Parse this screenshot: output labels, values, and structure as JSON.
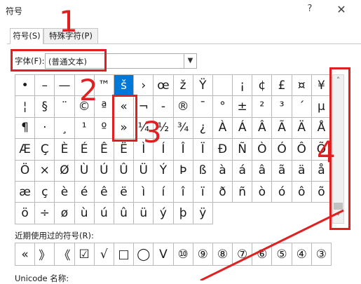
{
  "window": {
    "title": "符号",
    "help_label": "?",
    "close_label": "✕"
  },
  "tabs": [
    {
      "label": "符号(S)",
      "active": true
    },
    {
      "label": "特殊字符(P)",
      "active": false
    }
  ],
  "font": {
    "label": "字体(F):",
    "value": "(普通文本)",
    "dropdown_icon": "chevron-down-icon"
  },
  "symbols": [
    [
      "•",
      "–",
      "—",
      "˜",
      "™",
      "š",
      "›",
      "œ",
      "ž",
      "Ÿ",
      "",
      "¡",
      "¢",
      "£",
      "¤",
      "¥"
    ],
    [
      "¦",
      "§",
      "¨",
      "©",
      "ª",
      "«",
      "¬",
      "-",
      "®",
      "¯",
      "°",
      "±",
      "²",
      "³",
      "´",
      "µ"
    ],
    [
      "¶",
      "·",
      "¸",
      "¹",
      "º",
      "»",
      "¼",
      "½",
      "¾",
      "¿",
      "À",
      "Á",
      "Â",
      "Ã",
      "Ä",
      "Å"
    ],
    [
      "Æ",
      "Ç",
      "È",
      "É",
      "Ê",
      "Ë",
      "Ì",
      "Í",
      "Î",
      "Ï",
      "Ð",
      "Ñ",
      "Ò",
      "Ó",
      "Ô",
      "Õ"
    ],
    [
      "Ö",
      "×",
      "Ø",
      "Ù",
      "Ú",
      "Û",
      "Ü",
      "Ý",
      "Þ",
      "ß",
      "à",
      "á",
      "â",
      "ã",
      "ä",
      "å"
    ],
    [
      "æ",
      "ç",
      "è",
      "é",
      "ê",
      "ë",
      "ì",
      "í",
      "î",
      "ï",
      "ð",
      "ñ",
      "ò",
      "ó",
      "ô",
      "õ"
    ],
    [
      "ö",
      "÷",
      "ø",
      "ù",
      "ú",
      "û",
      "ü",
      "ý",
      "þ",
      "ÿ",
      "",
      "",
      "",
      "",
      "",
      ""
    ]
  ],
  "selected_symbol": "š",
  "recent": {
    "label": "近期使用过的符号(R):",
    "symbols": [
      "«",
      "》",
      "《",
      "☑",
      "√",
      "□",
      "◯",
      "V",
      "⑩",
      "⑨",
      "⑧",
      "⑦",
      "⑥",
      "⑤",
      "④",
      "③"
    ]
  },
  "unicode_label": "Unicode 名称:",
  "annotations": {
    "color": "#e02020",
    "numbers": [
      "1",
      "2",
      "3",
      "4"
    ]
  }
}
